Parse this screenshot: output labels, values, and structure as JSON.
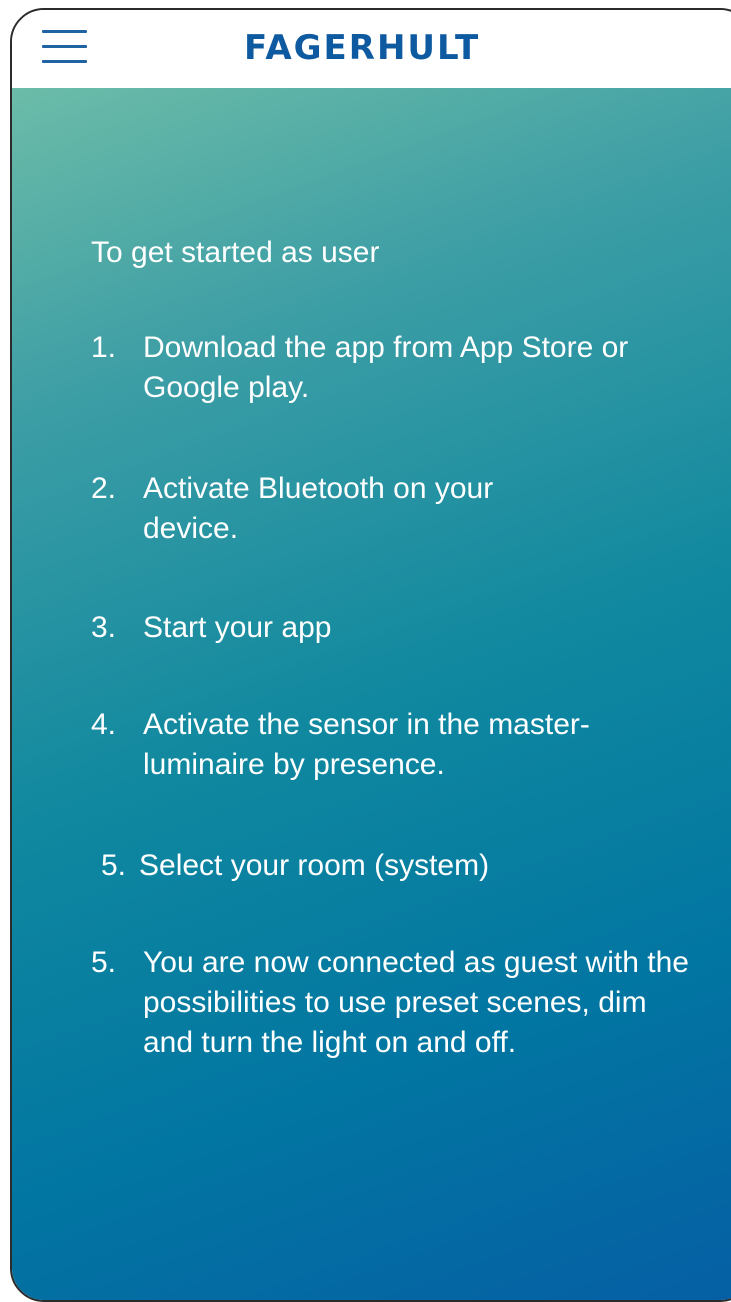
{
  "header": {
    "brand": "FAGERHULT"
  },
  "main": {
    "intro": "To get started as user",
    "steps": [
      {
        "num": "1.",
        "text": "Download the app from App Store or Google play."
      },
      {
        "num": "2.",
        "text": "Activate Bluetooth on your device."
      },
      {
        "num": "3.",
        "text": "Start your app"
      },
      {
        "num": "4.",
        "text": "Activate the sensor in the master-luminaire by presence."
      },
      {
        "num": "5.",
        "text": "Select your room (system)"
      },
      {
        "num": "5.",
        "text": "You are now connected as guest with the possibilities to use preset scenes, dim and turn the light on and off."
      }
    ]
  },
  "colors": {
    "brand": "#0e5aa0",
    "gradient_top": "#6cbca8",
    "gradient_bottom": "#065ea4"
  },
  "icons": {
    "menu": "hamburger-menu-icon"
  }
}
